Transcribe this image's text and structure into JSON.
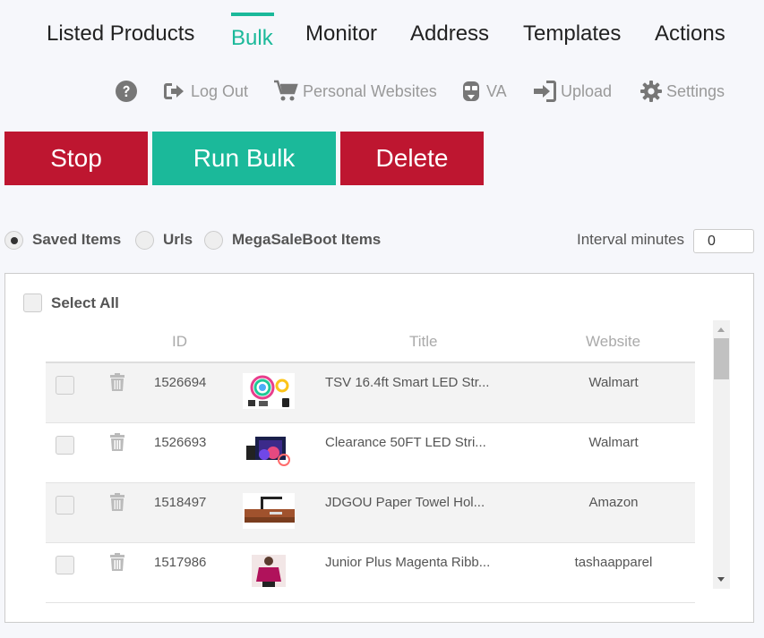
{
  "tabs": [
    {
      "label": "Listed Products",
      "active": false
    },
    {
      "label": "Bulk",
      "active": true
    },
    {
      "label": "Monitor",
      "active": false
    },
    {
      "label": "Address",
      "active": false
    },
    {
      "label": "Templates",
      "active": false
    },
    {
      "label": "Actions",
      "active": false
    }
  ],
  "subnav": {
    "help_icon": "question-circle-icon",
    "logout": "Log Out",
    "websites": "Personal Websites",
    "va": "VA",
    "upload": "Upload",
    "settings": "Settings"
  },
  "actions": {
    "stop": "Stop",
    "run_bulk": "Run Bulk",
    "delete": "Delete"
  },
  "source": {
    "options": [
      "Saved Items",
      "Urls",
      "MegaSaleBoot Items"
    ],
    "selected": "Saved Items"
  },
  "interval": {
    "label": "Interval minutes",
    "value": "0"
  },
  "table": {
    "select_all": "Select All",
    "columns": {
      "id": "ID",
      "title": "Title",
      "website": "Website"
    },
    "rows": [
      {
        "id": "1526694",
        "title": "TSV 16.4ft Smart LED Str...",
        "website": "Walmart",
        "image": "led-strip-thumbnail"
      },
      {
        "id": "1526693",
        "title": "Clearance 50FT LED Stri...",
        "website": "Walmart",
        "image": "led-strip-box-thumbnail"
      },
      {
        "id": "1518497",
        "title": "JDGOU Paper Towel Hol...",
        "website": "Amazon",
        "image": "paper-towel-holder-thumbnail"
      },
      {
        "id": "1517986",
        "title": "Junior Plus Magenta Ribb...",
        "website": "tashaapparel",
        "image": "magenta-top-thumbnail"
      }
    ]
  },
  "colors": {
    "accent": "#1bb99a",
    "danger": "#be1630"
  }
}
